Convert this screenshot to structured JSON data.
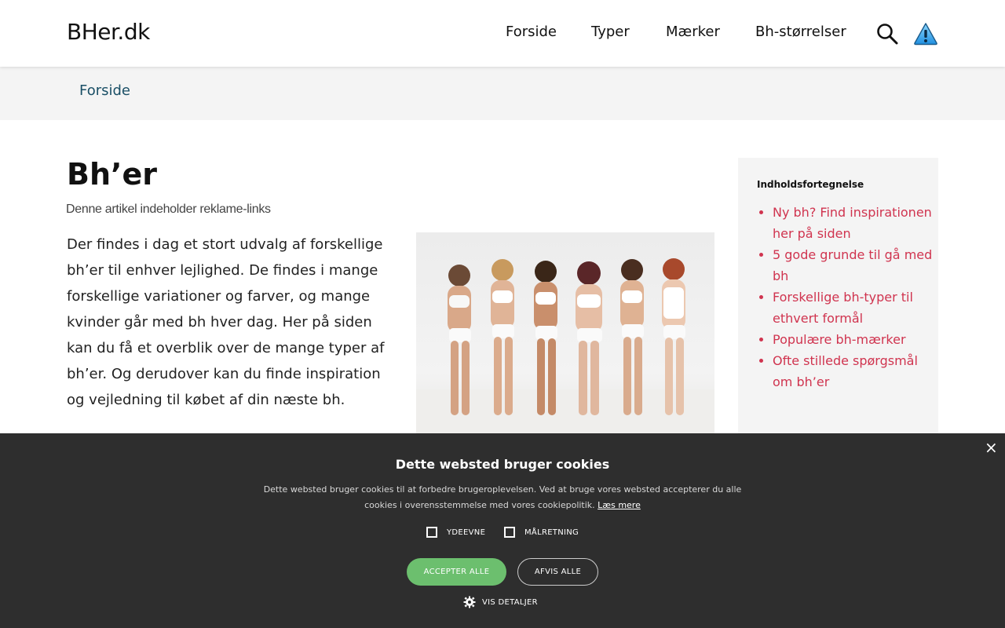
{
  "header": {
    "logo": "BHer.dk",
    "nav": [
      "Forside",
      "Typer",
      "Mærker",
      "Bh-størrelser"
    ],
    "icons": [
      "search-icon",
      "warning-icon"
    ]
  },
  "breadcrumb": {
    "item": "Forside"
  },
  "article": {
    "title": "Bh’er",
    "disclaimer": "Denne artikel indeholder reklame-links",
    "intro": "Der findes i dag et stort udvalg af forskellige bh’er til enhver lejlighed. De findes i mange forskellige variationer og farver, og mange kvinder går med bh hver dag. Her på siden kan du få et overblik over de mange typer af bh’er. Og derudover kan du finde inspiration og vejledning til købet af din næste bh."
  },
  "toc": {
    "title": "Indholdsfortegnelse",
    "items": [
      "Ny bh? Find inspirationen her på siden",
      "5 gode grunde til gå med bh",
      "Forskellige bh-typer til ethvert formål",
      "Populære bh-mærker",
      "Ofte stillede spørgsmål om bh’er"
    ]
  },
  "cookie": {
    "title": "Dette websted bruger cookies",
    "text": "Dette websted bruger cookies til at forbedre brugeroplevelsen. Ved at bruge vores websted accepterer du alle cookies i overensstemmelse med vores cookiepolitik.",
    "link": "Læs mere",
    "options": [
      "YDEEVNE",
      "MÅLRETNING"
    ],
    "accept": "ACCEPTER ALLE",
    "reject": "AFVIS ALLE",
    "details": "VIS DETALJER",
    "close": "×"
  },
  "colors": {
    "accent": "#d0344f",
    "breadcrumb": "#1a4f66",
    "banner_bg": "#2e2e2e",
    "accept_btn": "#6cbf6e"
  }
}
